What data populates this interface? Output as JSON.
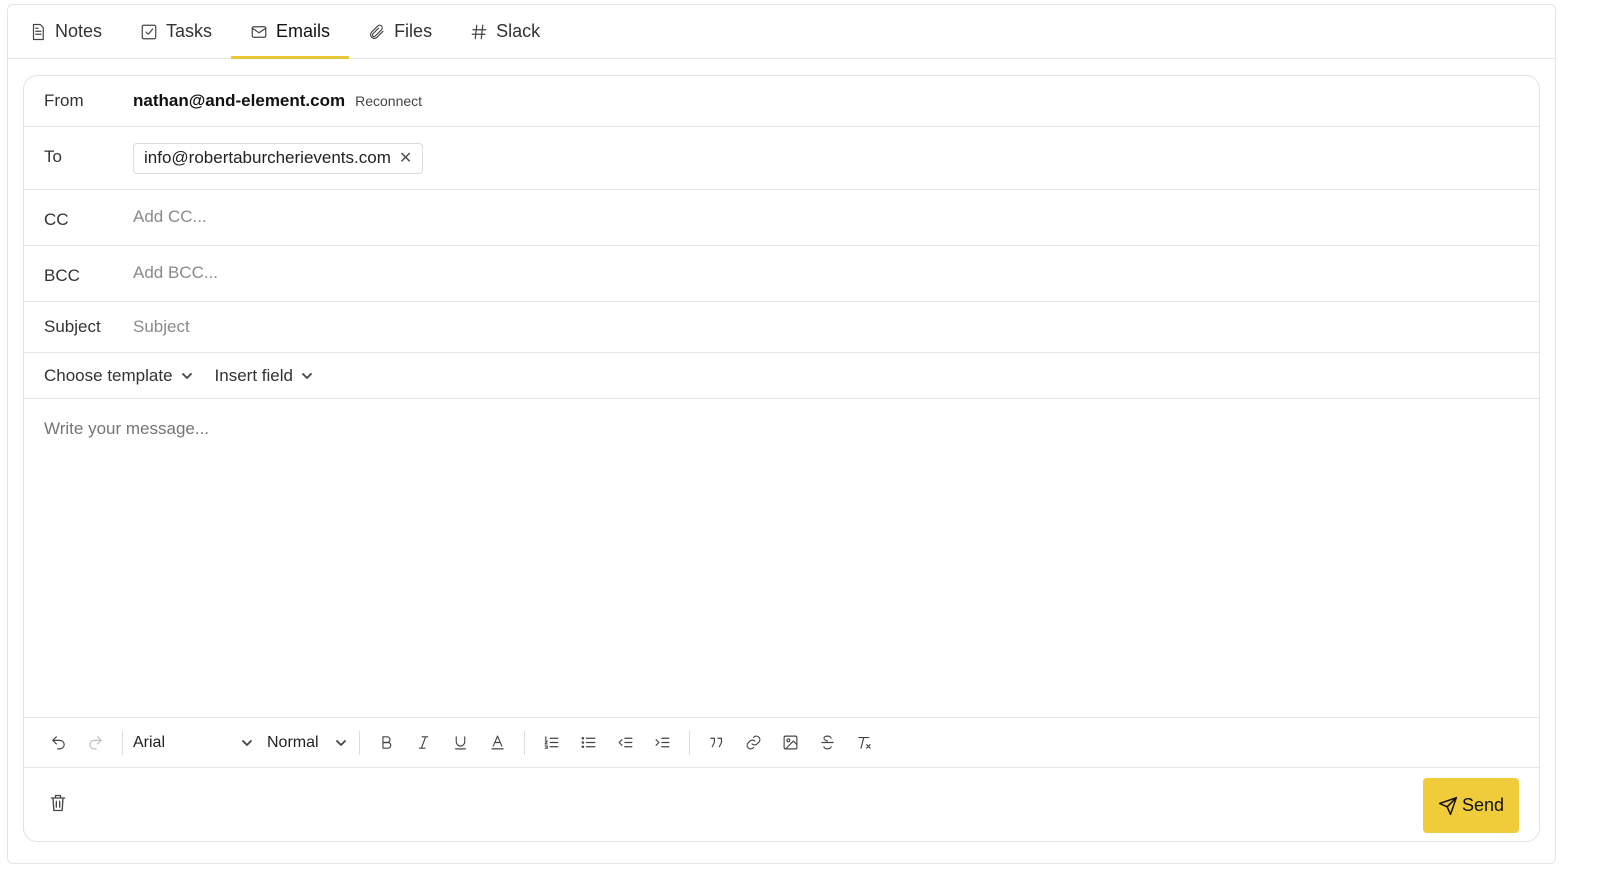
{
  "tabs": [
    {
      "label": "Notes",
      "icon": "document-icon"
    },
    {
      "label": "Tasks",
      "icon": "checkbox-icon"
    },
    {
      "label": "Emails",
      "icon": "mail-icon",
      "active": true
    },
    {
      "label": "Files",
      "icon": "paperclip-icon"
    },
    {
      "label": "Slack",
      "icon": "hash-icon"
    }
  ],
  "compose": {
    "from_label": "From",
    "from_email": "nathan@and-element.com",
    "reconnect_label": "Reconnect",
    "to_label": "To",
    "to_recipient": "info@robertaburcherievents.com",
    "cc_label": "CC",
    "cc_placeholder": "Add CC...",
    "bcc_label": "BCC",
    "bcc_placeholder": "Add BCC...",
    "subject_label": "Subject",
    "subject_placeholder": "Subject",
    "template_label": "Choose template",
    "insert_field_label": "Insert field",
    "message_placeholder": "Write your message..."
  },
  "toolbar": {
    "font": "Arial",
    "size": "Normal"
  },
  "footer": {
    "send_label": "Send"
  },
  "colors": {
    "accent": "#f0cb3a",
    "tab_underline": "#e8c73a"
  }
}
